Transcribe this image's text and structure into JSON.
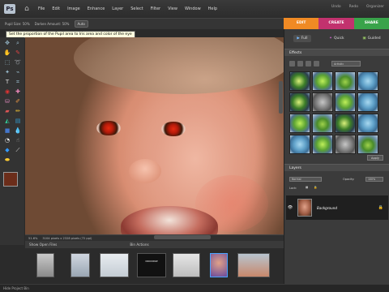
{
  "app": {
    "logo": "Ps",
    "menus": [
      "File",
      "Edit",
      "Image",
      "Enhance",
      "Layer",
      "Select",
      "Filter",
      "View",
      "Window",
      "Help"
    ],
    "top_right": [
      "Undo",
      "Redo",
      "Organizer"
    ]
  },
  "options_bar": {
    "pupil_size": "Pupil Size: 50%",
    "darken_amount": "Darken Amount: 50%",
    "auto_button": "Auto",
    "tooltip": "Set the proportion of the Pupil area to Iris area and color of the eye"
  },
  "mode_tabs": {
    "edit": "EDIT",
    "create": "CREATE",
    "share": "SHARE"
  },
  "edit_subtabs": {
    "full": "Full",
    "quick": "Quick",
    "guided": "Guided"
  },
  "effects": {
    "header": "Effects",
    "dropdown": "Artistic",
    "apply_label": "Apply",
    "swatch_count": 16
  },
  "layers": {
    "header": "Layers",
    "blend_mode": "Normal",
    "opacity_label": "Opacity:",
    "opacity_value": "100%",
    "lock_label": "Lock:",
    "layer_name": "Background"
  },
  "status": {
    "zoom": "51.6%",
    "doc_size": "3104 pixels x 2328 pixels (72 ppi)"
  },
  "project_bin": {
    "title": "Show Open Files",
    "actions_label": "Bin Actions",
    "thumb_caption": "CROCODILE",
    "show_files": "Hide Project Bin"
  },
  "colors": {
    "edit_tab": "#f08a24",
    "create_tab": "#c2326e",
    "share_tab": "#39a34a",
    "foreground_color": "#6b2d1a",
    "background_color": "#ffffff"
  }
}
